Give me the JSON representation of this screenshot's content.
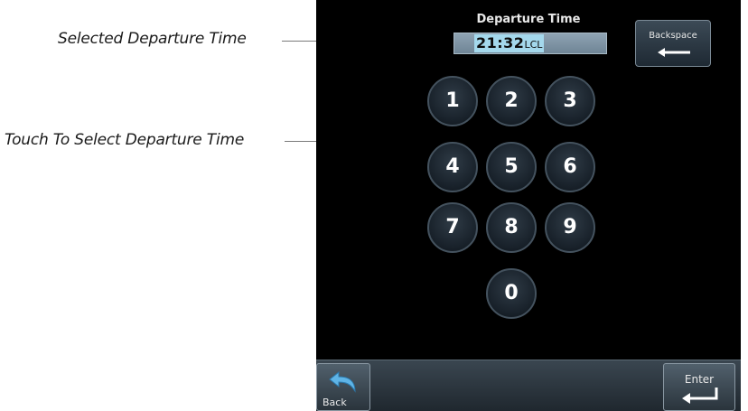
{
  "annotations": {
    "selected_time": "Selected Departure Time",
    "touch_select": "Touch To Select Departure Time"
  },
  "screen": {
    "field_title": "Departure Time",
    "time_value": "21:32",
    "time_unit": "LCL",
    "backspace_label": "Backspace",
    "keys": [
      "1",
      "2",
      "3",
      "4",
      "5",
      "6",
      "7",
      "8",
      "9",
      "0"
    ],
    "back_label": "Back",
    "enter_label": "Enter"
  },
  "colors": {
    "screen_bg": "#000000",
    "field_highlight": "#a4d8ec",
    "key_border": "#44525e"
  },
  "icons": {
    "backspace": "left-arrow-icon",
    "back": "curved-back-arrow-icon",
    "enter": "enter-return-icon"
  }
}
